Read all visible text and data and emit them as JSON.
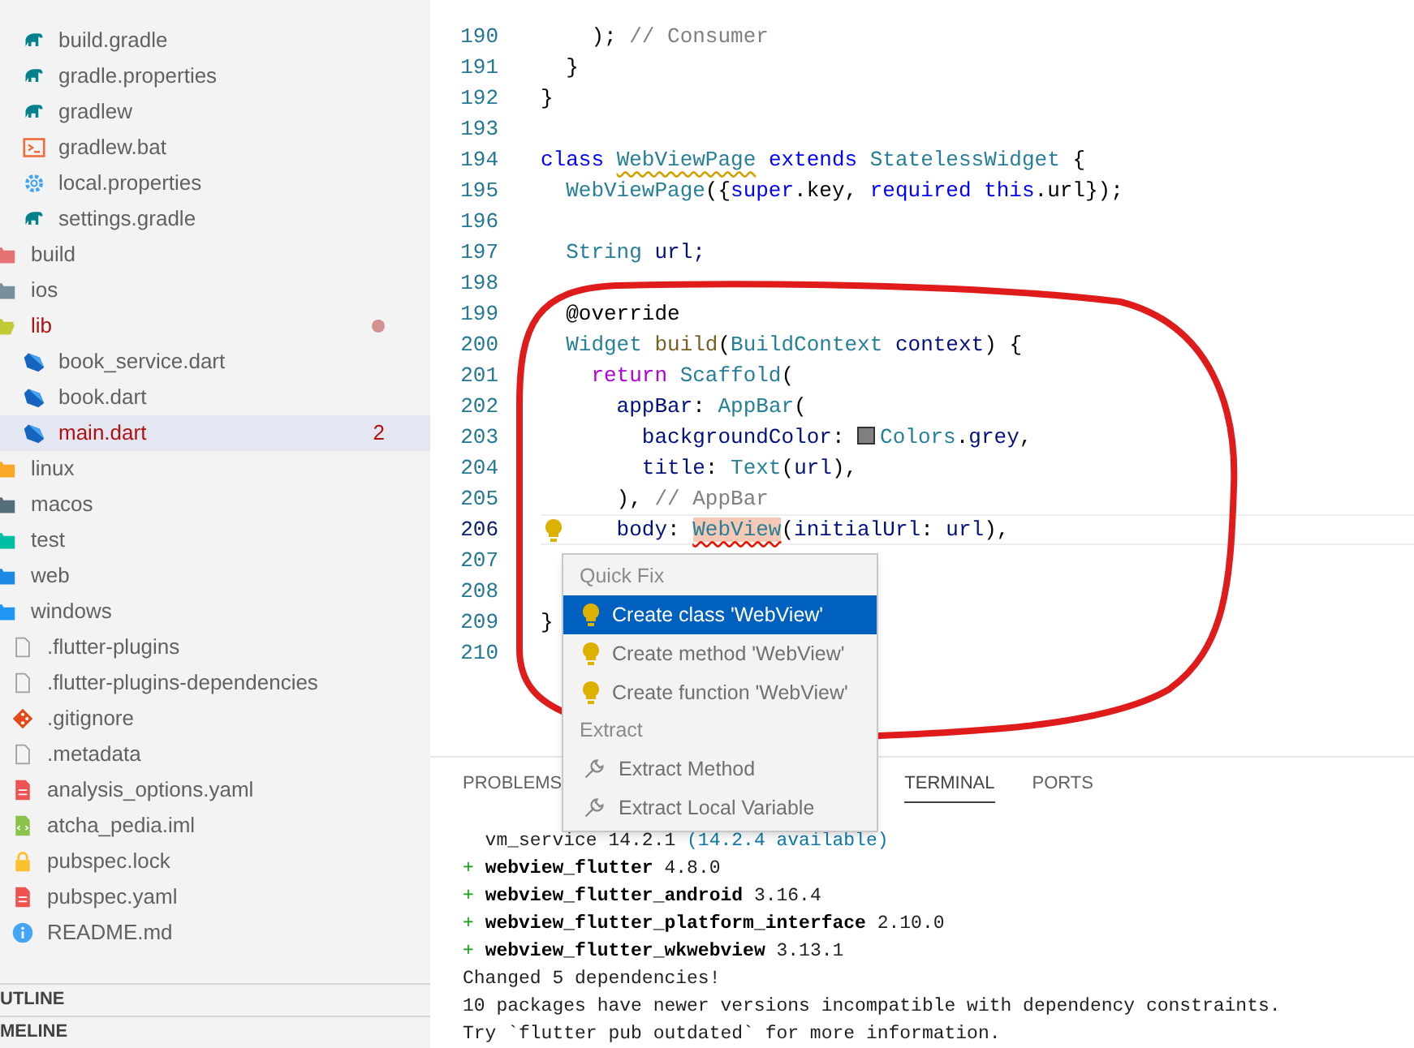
{
  "sidebar": {
    "tree": [
      {
        "children": [
          {
            "label": "build.gradle",
            "kind": "gradle",
            "selected": false
          },
          {
            "label": "gradle.properties",
            "kind": "gradle",
            "selected": false
          },
          {
            "label": "gradlew",
            "kind": "gradle",
            "selected": false
          },
          {
            "label": "gradlew.bat",
            "kind": "terminal",
            "selected": false
          },
          {
            "label": "local.properties",
            "kind": "settings",
            "selected": false
          },
          {
            "label": "settings.gradle",
            "kind": "gradle",
            "selected": false
          }
        ]
      },
      {
        "label": "build",
        "kind": "folder",
        "color": "#e57373",
        "expanded": false,
        "selected": false
      },
      {
        "label": "ios",
        "kind": "folder",
        "color": "#78909c",
        "expanded": false,
        "selected": false
      },
      {
        "label": "lib",
        "kind": "folder",
        "color": "#c0ca33",
        "expanded": true,
        "selected": false,
        "error": true,
        "dot": true,
        "children": [
          {
            "label": "book_service.dart",
            "kind": "dart",
            "selected": false
          },
          {
            "label": "book.dart",
            "kind": "dart",
            "selected": false
          },
          {
            "label": "main.dart",
            "kind": "dart",
            "selected": true,
            "error": true,
            "badge": "2"
          }
        ]
      },
      {
        "label": "linux",
        "kind": "folder",
        "color": "#f9a825",
        "expanded": false,
        "selected": false
      },
      {
        "label": "macos",
        "kind": "folder",
        "color": "#546e7a",
        "expanded": false,
        "selected": false
      },
      {
        "label": "test",
        "kind": "folder",
        "color": "#00bfa5",
        "expanded": false,
        "selected": false
      },
      {
        "label": "web",
        "kind": "folder",
        "color": "#1e88e5",
        "expanded": false,
        "selected": false
      },
      {
        "label": "windows",
        "kind": "folder",
        "color": "#2196f3",
        "expanded": false,
        "selected": false
      },
      {
        "label": ".flutter-plugins",
        "kind": "file",
        "selected": false
      },
      {
        "label": ".flutter-plugins-dependencies",
        "kind": "file",
        "selected": false
      },
      {
        "label": ".gitignore",
        "kind": "git",
        "selected": false
      },
      {
        "label": ".metadata",
        "kind": "file",
        "selected": false
      },
      {
        "label": "analysis_options.yaml",
        "kind": "yaml",
        "selected": false
      },
      {
        "label": "atcha_pedia.iml",
        "kind": "xml",
        "selected": false
      },
      {
        "label": "pubspec.lock",
        "kind": "lock",
        "selected": false
      },
      {
        "label": "pubspec.yaml",
        "kind": "yaml",
        "selected": false
      },
      {
        "label": "README.md",
        "kind": "info",
        "selected": false
      }
    ],
    "sections": [
      "UTLINE",
      "MELINE"
    ]
  },
  "editor": {
    "lines": [
      {
        "number": "190",
        "current": false,
        "tokens": [
          {
            "text": "    ); ",
            "kind": "plain"
          },
          {
            "text": "// Consumer",
            "kind": "comment"
          }
        ]
      },
      {
        "number": "191",
        "current": false,
        "tokens": [
          {
            "text": "  }",
            "kind": "plain"
          }
        ]
      },
      {
        "number": "192",
        "current": false,
        "tokens": [
          {
            "text": "}",
            "kind": "plain"
          }
        ]
      },
      {
        "number": "193",
        "current": false
      },
      {
        "number": "194",
        "current": false,
        "tokens": [
          {
            "text": "class ",
            "kind": "keyword"
          },
          {
            "text": "WebViewPage",
            "kind": "type",
            "warning": true
          },
          {
            "text": " extends ",
            "kind": "keyword"
          },
          {
            "text": "StatelessWidget",
            "kind": "type"
          },
          {
            "text": " {",
            "kind": "plain"
          }
        ]
      },
      {
        "number": "195",
        "current": false,
        "tokens": [
          {
            "text": "  WebViewPage",
            "kind": "type"
          },
          {
            "text": "({",
            "kind": "plain"
          },
          {
            "text": "super",
            "kind": "keyword"
          },
          {
            "text": ".key, ",
            "kind": "plain"
          },
          {
            "text": "required this",
            "kind": "keyword"
          },
          {
            "text": ".url});",
            "kind": "plain"
          }
        ]
      },
      {
        "number": "196",
        "current": false
      },
      {
        "number": "197",
        "current": false,
        "tokens": [
          {
            "text": "  String",
            "kind": "type"
          },
          {
            "text": " url;",
            "kind": "variable"
          }
        ]
      },
      {
        "number": "198",
        "current": false
      },
      {
        "number": "199",
        "current": false,
        "tokens": [
          {
            "text": "  @override",
            "kind": "plain"
          }
        ]
      },
      {
        "number": "200",
        "current": false,
        "tokens": [
          {
            "text": "  Widget",
            "kind": "type"
          },
          {
            "text": " build",
            "kind": "function"
          },
          {
            "text": "(",
            "kind": "plain"
          },
          {
            "text": "BuildContext",
            "kind": "type"
          },
          {
            "text": " context",
            "kind": "variable"
          },
          {
            "text": ") {",
            "kind": "plain"
          }
        ]
      },
      {
        "number": "201",
        "current": false,
        "tokens": [
          {
            "text": "    return",
            "kind": "control"
          },
          {
            "text": " Scaffold",
            "kind": "type"
          },
          {
            "text": "(",
            "kind": "plain"
          }
        ]
      },
      {
        "number": "202",
        "current": false,
        "tokens": [
          {
            "text": "      appBar",
            "kind": "variable"
          },
          {
            "text": ": ",
            "kind": "plain"
          },
          {
            "text": "AppBar",
            "kind": "type"
          },
          {
            "text": "(",
            "kind": "plain"
          }
        ]
      },
      {
        "number": "203",
        "current": false,
        "tokens": [
          {
            "text": "        backgroundColor",
            "kind": "variable"
          },
          {
            "text": ": ",
            "kind": "plain"
          },
          {
            "kind": "swatch",
            "color": "#808080"
          },
          {
            "text": "Colors",
            "kind": "type"
          },
          {
            "text": ".",
            "kind": "plain"
          },
          {
            "text": "grey",
            "kind": "variable"
          },
          {
            "text": ",",
            "kind": "plain"
          }
        ]
      },
      {
        "number": "204",
        "current": false,
        "tokens": [
          {
            "text": "        title",
            "kind": "variable"
          },
          {
            "text": ": ",
            "kind": "plain"
          },
          {
            "text": "Text",
            "kind": "type"
          },
          {
            "text": "(",
            "kind": "plain"
          },
          {
            "text": "url",
            "kind": "variable"
          },
          {
            "text": "),",
            "kind": "plain"
          }
        ]
      },
      {
        "number": "205",
        "current": false,
        "tokens": [
          {
            "text": "      ), ",
            "kind": "plain"
          },
          {
            "text": "// AppBar",
            "kind": "comment"
          }
        ]
      },
      {
        "number": "206",
        "current": true,
        "lightbulb": true,
        "tokens": [
          {
            "text": "      body",
            "kind": "variable"
          },
          {
            "text": ": ",
            "kind": "plain"
          },
          {
            "text": "WebView",
            "kind": "type",
            "error": true
          },
          {
            "text": "(",
            "kind": "plain"
          },
          {
            "text": "initialUrl",
            "kind": "variable"
          },
          {
            "text": ": ",
            "kind": "plain"
          },
          {
            "text": "url",
            "kind": "variable"
          },
          {
            "text": "),",
            "kind": "plain"
          }
        ]
      },
      {
        "number": "207",
        "current": false
      },
      {
        "number": "208",
        "current": false
      },
      {
        "number": "209",
        "current": false,
        "tokens": [
          {
            "text": "}",
            "kind": "plain"
          }
        ]
      },
      {
        "number": "210",
        "current": false
      }
    ]
  },
  "quick_fix_menu": {
    "groups": [
      {
        "title": "Quick Fix",
        "items": [
          {
            "label": "Create class 'WebView'",
            "kind": "fix",
            "selected": true
          },
          {
            "label": "Create method 'WebView'",
            "kind": "fix",
            "selected": false
          },
          {
            "label": "Create function 'WebView'",
            "kind": "fix",
            "selected": false
          }
        ]
      },
      {
        "title": "Extract",
        "items": [
          {
            "label": "Extract Method",
            "kind": "refactor",
            "selected": false
          },
          {
            "label": "Extract Local Variable",
            "kind": "refactor",
            "selected": false
          }
        ]
      }
    ]
  },
  "panel": {
    "tabs": [
      {
        "label": "PROBLEMS",
        "selected": false
      },
      {
        "label": "TERMINAL",
        "selected": true
      },
      {
        "label": "PORTS",
        "selected": false
      }
    ],
    "terminal_lines": [
      [
        {
          "text": "  vm_service 14.2.1 ",
          "kind": "plain"
        },
        {
          "text": "(14.2.4 available)",
          "kind": "hint"
        }
      ],
      [
        {
          "text": "+ ",
          "kind": "added"
        },
        {
          "text": "webview_flutter",
          "kind": "package"
        },
        {
          "text": " 4.8.0",
          "kind": "plain"
        }
      ],
      [
        {
          "text": "+ ",
          "kind": "added"
        },
        {
          "text": "webview_flutter_android",
          "kind": "package"
        },
        {
          "text": " 3.16.4",
          "kind": "plain"
        }
      ],
      [
        {
          "text": "+ ",
          "kind": "added"
        },
        {
          "text": "webview_flutter_platform_interface",
          "kind": "package"
        },
        {
          "text": " 2.10.0",
          "kind": "plain"
        }
      ],
      [
        {
          "text": "+ ",
          "kind": "added"
        },
        {
          "text": "webview_flutter_wkwebview",
          "kind": "package"
        },
        {
          "text": " 3.13.1",
          "kind": "plain"
        }
      ],
      [
        {
          "text": "Changed 5 dependencies!",
          "kind": "plain"
        }
      ],
      [
        {
          "text": "10 packages have newer versions incompatible with dependency constraints.",
          "kind": "plain"
        }
      ],
      [
        {
          "text": "Try `flutter pub outdated` for more information.",
          "kind": "plain"
        }
      ]
    ]
  }
}
